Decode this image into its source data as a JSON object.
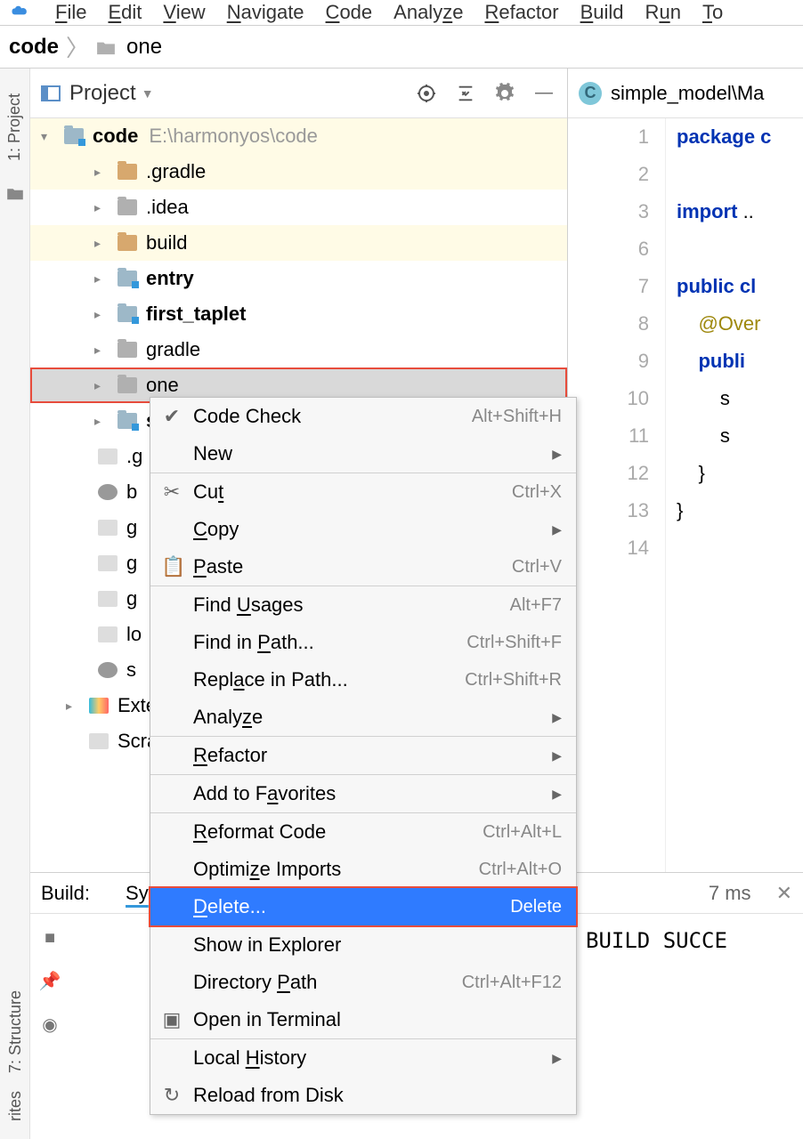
{
  "menubar": [
    "File",
    "Edit",
    "View",
    "Navigate",
    "Code",
    "Analyze",
    "Refactor",
    "Build",
    "Run",
    "To"
  ],
  "breadcrumb": {
    "root": "code",
    "leaf": "one"
  },
  "left_tab": "1: Project",
  "panel": {
    "title": "Project"
  },
  "tree": {
    "root": {
      "name": "code",
      "path": "E:\\harmonyos\\code"
    },
    "children": [
      {
        "name": ".gradle",
        "type": "folder",
        "color": "orange"
      },
      {
        "name": ".idea",
        "type": "folder",
        "color": "grey"
      },
      {
        "name": "build",
        "type": "folder",
        "color": "orange"
      },
      {
        "name": "entry",
        "type": "folder",
        "color": "blue",
        "bold": true
      },
      {
        "name": "first_taplet",
        "type": "folder",
        "color": "blue",
        "bold": true
      },
      {
        "name": "gradle",
        "type": "folder",
        "color": "grey"
      },
      {
        "name": "one",
        "type": "folder",
        "color": "grey",
        "selected": true,
        "highlight": true
      },
      {
        "name": "s",
        "type": "folder",
        "color": "blue",
        "bold": true
      },
      {
        "name": ".g",
        "type": "file"
      },
      {
        "name": "b",
        "type": "gradle"
      },
      {
        "name": "g",
        "type": "file"
      },
      {
        "name": "g",
        "type": "file"
      },
      {
        "name": "g",
        "type": "file"
      },
      {
        "name": "lo",
        "type": "file"
      },
      {
        "name": "s",
        "type": "gradle"
      }
    ],
    "ext": "Exte",
    "scratch": "Scra"
  },
  "editor": {
    "tab": "simple_model\\Ma",
    "gutter": [
      "1",
      "2",
      "3",
      "6",
      "7",
      "8",
      "9",
      "10",
      "11",
      "12",
      "13",
      "14"
    ],
    "lines": {
      "l1": "package c",
      "l3a": "import",
      "l3b": " ..",
      "l7": "public cl",
      "l8a": "    @Over",
      "l9": "    publi",
      "l10": "        s",
      "l11": "        s",
      "l12": "    }",
      "l13": "}"
    }
  },
  "context_menu": [
    {
      "label": "Code Check",
      "shortcut": "Alt+Shift+H",
      "icon": "check"
    },
    {
      "label": "New",
      "submenu": true
    },
    {
      "sep": true
    },
    {
      "label": "Cut",
      "shortcut": "Ctrl+X",
      "icon": "cut"
    },
    {
      "label": "Copy",
      "submenu": true
    },
    {
      "label": "Paste",
      "shortcut": "Ctrl+V",
      "icon": "paste"
    },
    {
      "sep": true
    },
    {
      "label": "Find Usages",
      "shortcut": "Alt+F7"
    },
    {
      "label": "Find in Path...",
      "shortcut": "Ctrl+Shift+F"
    },
    {
      "label": "Replace in Path...",
      "shortcut": "Ctrl+Shift+R"
    },
    {
      "label": "Analyze",
      "submenu": true
    },
    {
      "sep": true
    },
    {
      "label": "Refactor",
      "submenu": true
    },
    {
      "sep": true
    },
    {
      "label": "Add to Favorites",
      "submenu": true
    },
    {
      "sep": true
    },
    {
      "label": "Reformat Code",
      "shortcut": "Ctrl+Alt+L"
    },
    {
      "label": "Optimize Imports",
      "shortcut": "Ctrl+Alt+O"
    },
    {
      "label": "Delete...",
      "shortcut": "Delete",
      "selected": true,
      "highlight": true
    },
    {
      "sep": true
    },
    {
      "label": "Show in Explorer"
    },
    {
      "label": "Directory Path",
      "shortcut": "Ctrl+Alt+F12"
    },
    {
      "label": "Open in Terminal",
      "icon": "terminal"
    },
    {
      "sep": true
    },
    {
      "label": "Local History",
      "submenu": true
    },
    {
      "label": "Reload from Disk",
      "icon": "reload"
    }
  ],
  "build": {
    "title": "Build:",
    "tab": "Sy",
    "time": "7 ms",
    "message": "BUILD SUCCE"
  },
  "bottom_tabs": {
    "structure": "7: Structure",
    "fav": "rites"
  }
}
